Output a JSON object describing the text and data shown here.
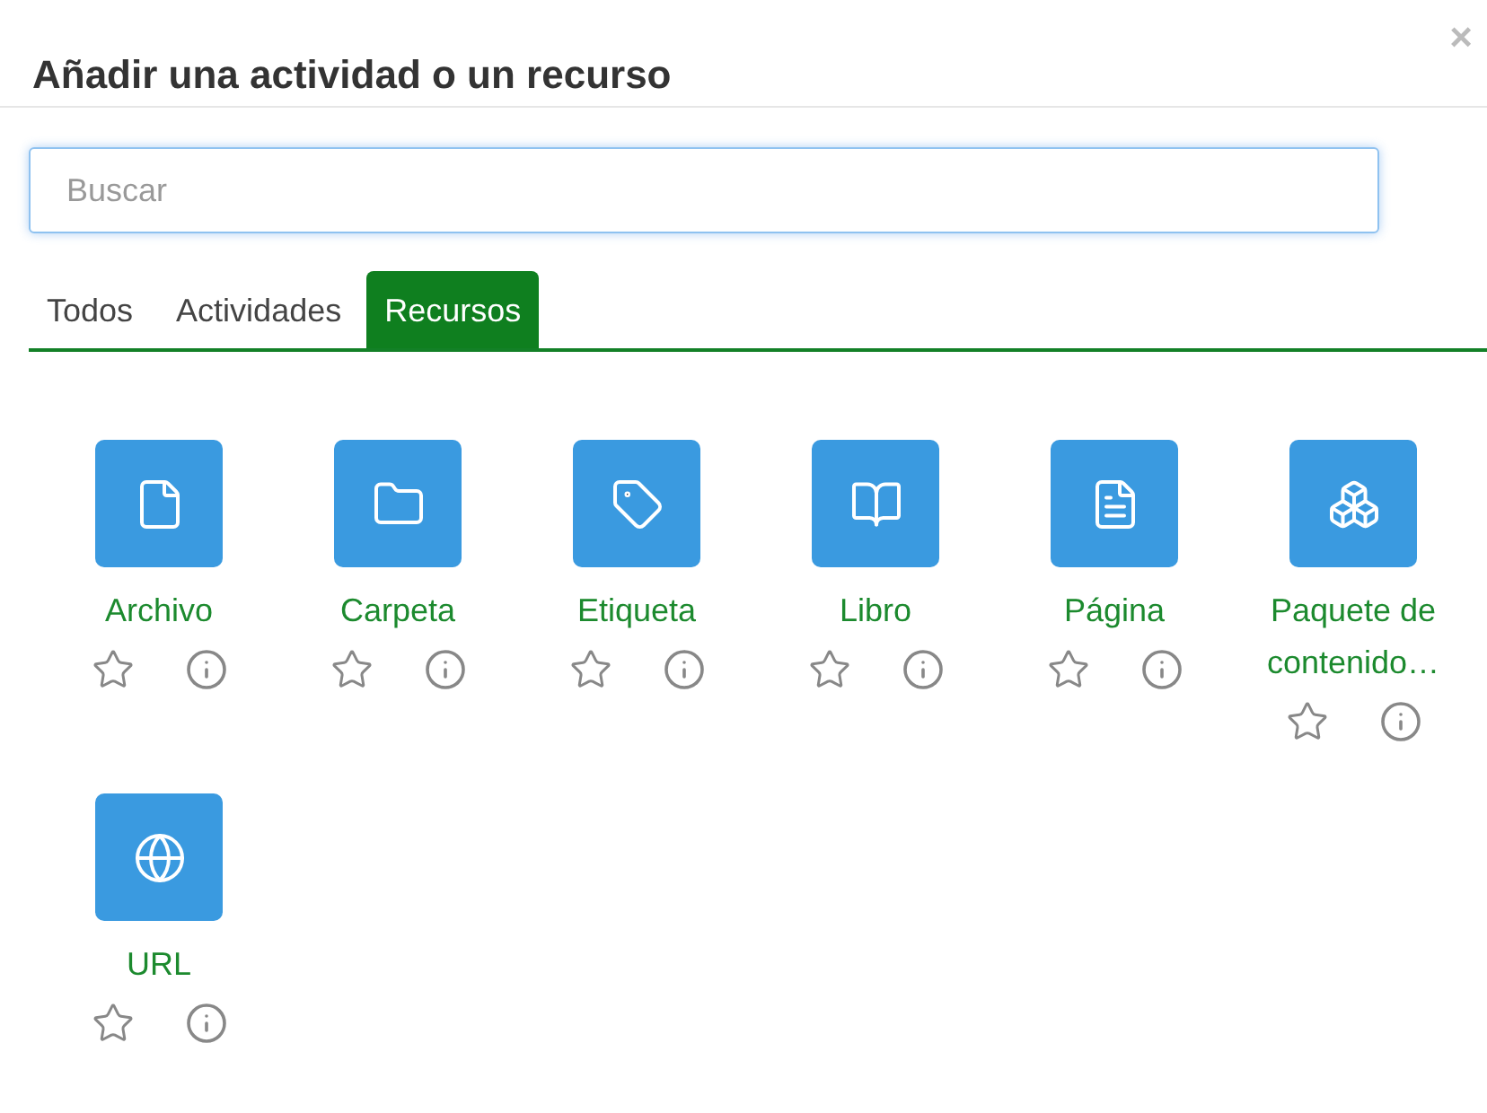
{
  "dialog": {
    "title": "Añadir una actividad o un recurso",
    "close": "×"
  },
  "search": {
    "placeholder": "Buscar"
  },
  "tabs": [
    {
      "label": "Todos",
      "selected": false
    },
    {
      "label": "Actividades",
      "selected": false
    },
    {
      "label": "Recursos",
      "selected": true
    }
  ],
  "items": [
    {
      "label": "Archivo",
      "starred": false
    },
    {
      "label": "Carpeta",
      "starred": false
    },
    {
      "label": "Etiqueta",
      "starred": false
    },
    {
      "label": "Libro",
      "starred": false
    },
    {
      "label": "Página",
      "starred": false
    },
    {
      "label": "Paquete de contenido…",
      "starred": false
    },
    {
      "label": "URL",
      "starred": false
    }
  ]
}
